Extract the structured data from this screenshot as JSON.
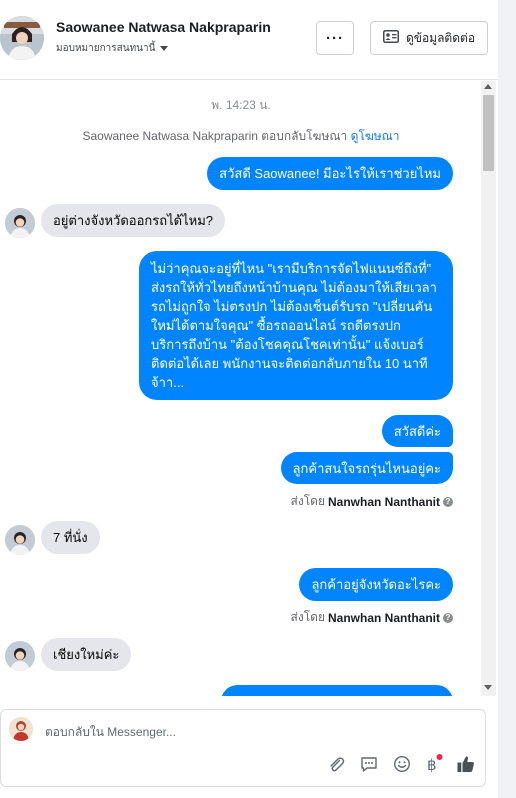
{
  "header": {
    "name": "Saowanee Natwasa Nakpraparin",
    "assign_label": "มอบหมายการสนทนานี้",
    "more_label": "···",
    "contact_label": "ดูข้อมูลติดต่อ"
  },
  "thread": {
    "timestamp": "พ. 14:23 น.",
    "reply_note_prefix": "Saowanee Natwasa Nakpraparin ตอบกลับโฆษณา",
    "reply_note_link": "ดูโฆษณา",
    "messages": [
      {
        "side": "out",
        "text": "สวัสดี Saowanee! มีอะไรให้เราช่วยไหม"
      },
      {
        "side": "in",
        "text": "อยู่ต่างจังหวัดออกรถได้ไหม?"
      },
      {
        "side": "out",
        "text": "ไม่ว่าคุณจะอยู่ที่ไหน \"เรามีบริการจัดไฟแนนซ์ถึงที่\"  ส่งรถให้ทั่วไทยถึงหน้าบ้านคุณ ไม่ต้องมาให้เสียเวลา รถไม่ถูกใจ ไม่ตรงปก ไม่ต้องเซ็นต์รับรถ \"เปลี่ยนคันใหม่ได้ตามใจคุณ\" ซื้อรถออนไลน์ รถดีตรงปก บริการถึงบ้าน \"ต้องโชคคุณโชคเท่านั้น\" แจ้งเบอร์ติดต่อได้เลย พนักงานจะติดต่อกลับภายใน 10 นาทีจ้าา..."
      },
      {
        "side": "out",
        "text": "สวัสดีค่ะ"
      },
      {
        "side": "out",
        "text": "ลูกค้าสนใจรถรุ่นไหนอยู่คะ"
      },
      {
        "side": "in",
        "text": "7 ที่นั่ง"
      },
      {
        "side": "out",
        "text": "ลูกค้าอยู่จังหวัดอะไรคะ"
      },
      {
        "side": "in",
        "text": "เชียงใหม่ค่ะ"
      }
    ],
    "sent_by_prefix": "ส่งโดย",
    "sent_by_name": "Nanwhan Nanthanit"
  },
  "composer": {
    "placeholder": "ตอบกลับใน Messenger..."
  },
  "colors": {
    "accent": "#0084ff",
    "incoming_bubble": "#e4e6eb",
    "link": "#1877f2"
  },
  "icons": [
    "more-icon",
    "contact-card-icon",
    "paperclip-icon",
    "saved-reply-icon",
    "emoji-icon",
    "baht-icon",
    "thumbs-up-icon"
  ]
}
